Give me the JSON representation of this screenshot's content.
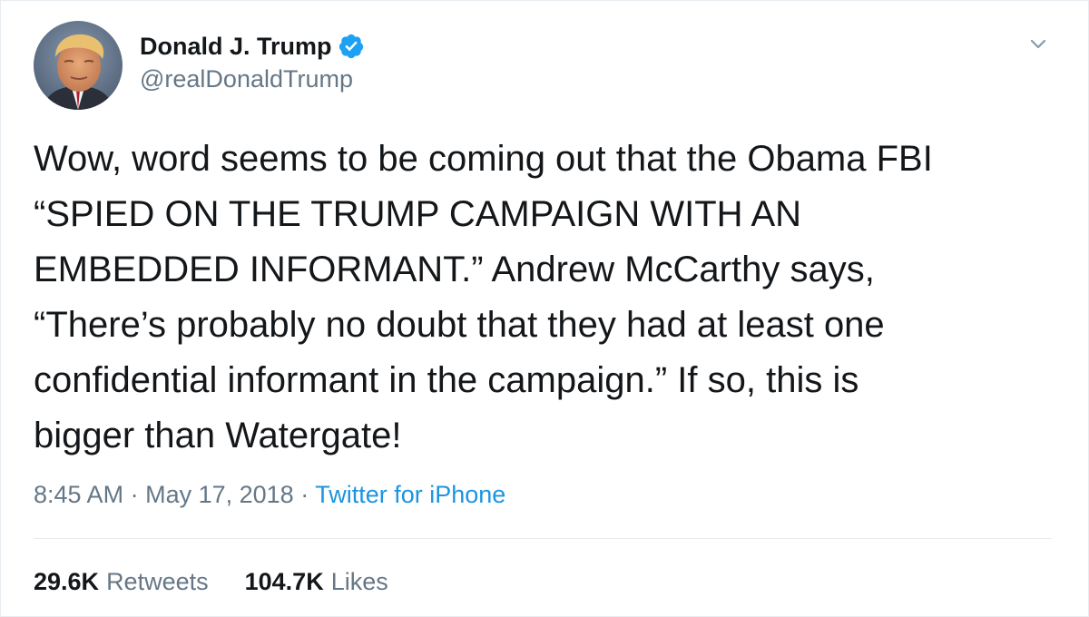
{
  "user": {
    "display_name": "Donald J. Trump",
    "handle": "@realDonaldTrump",
    "verified": true,
    "verified_color": "#1da1f2"
  },
  "tweet": {
    "lines": [
      "Wow, word seems to be coming out that the Obama FBI",
      "“SPIED ON THE TRUMP CAMPAIGN WITH AN",
      "EMBEDDED INFORMANT.” Andrew McCarthy says,",
      "“There’s probably no doubt that they had at least one",
      "confidential informant in the campaign.” If so, this is",
      "bigger than Watergate!"
    ],
    "time": "8:45 AM",
    "separator": "·",
    "date": "May 17, 2018",
    "source": "Twitter for iPhone"
  },
  "stats": {
    "retweets_count": "29.6K",
    "retweets_label": "Retweets",
    "likes_count": "104.7K",
    "likes_label": "Likes"
  },
  "icons": {
    "avatar": "avatar-photo",
    "verified": "verified-badge-icon",
    "menu": "chevron-down-icon"
  },
  "colors": {
    "text": "#14171a",
    "secondary": "#657786",
    "link": "#1b95e0",
    "border": "#e6ecf0"
  }
}
